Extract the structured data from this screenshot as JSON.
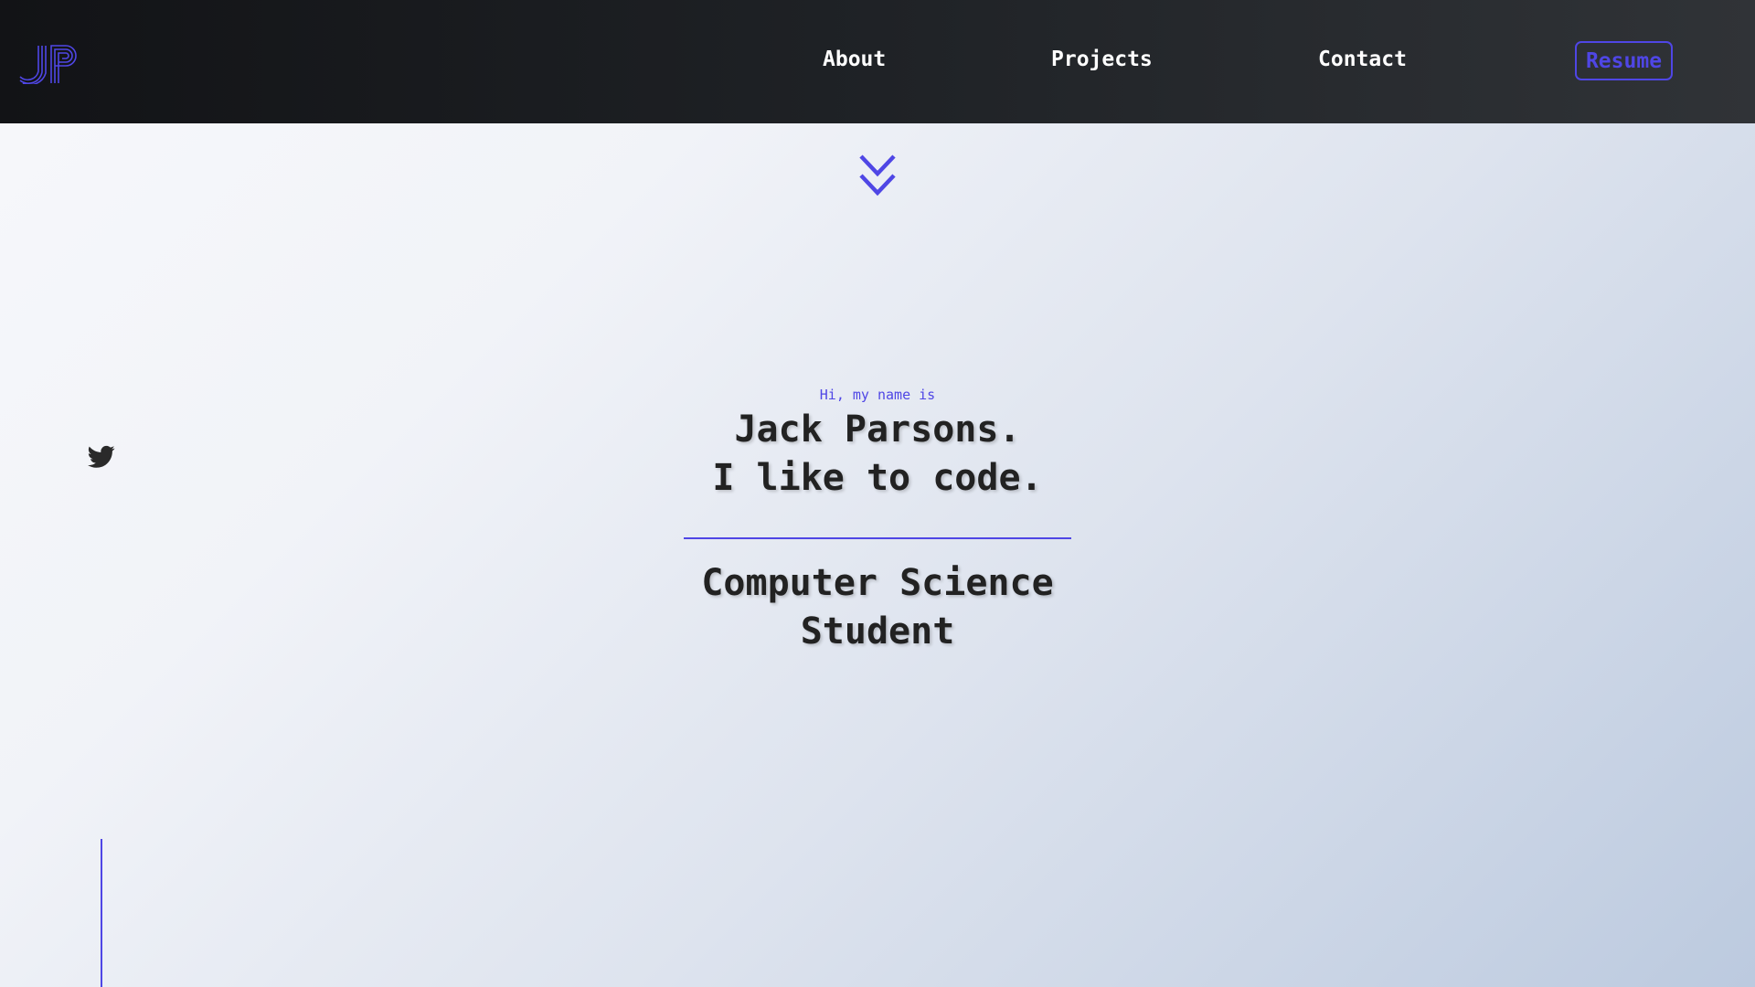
{
  "header": {
    "logo_text": "JP",
    "nav": {
      "about": "About",
      "projects": "Projects",
      "contact": "Contact"
    },
    "resume_label": "Resume"
  },
  "hero": {
    "greeting": "Hi, my name is",
    "headline_line1": "Jack Parsons.",
    "headline_line2": "I like to code.",
    "subtitle_line1": "Computer Science",
    "subtitle_line2": "Student"
  },
  "icons": {
    "scroll": "double-chevron-down-icon",
    "social": "twitter-icon"
  },
  "colors": {
    "accent": "#4f46e5",
    "nav_text": "#ffffff",
    "heading_text": "#222222",
    "header_bg_start": "#121316",
    "header_bg_end": "#303337"
  }
}
